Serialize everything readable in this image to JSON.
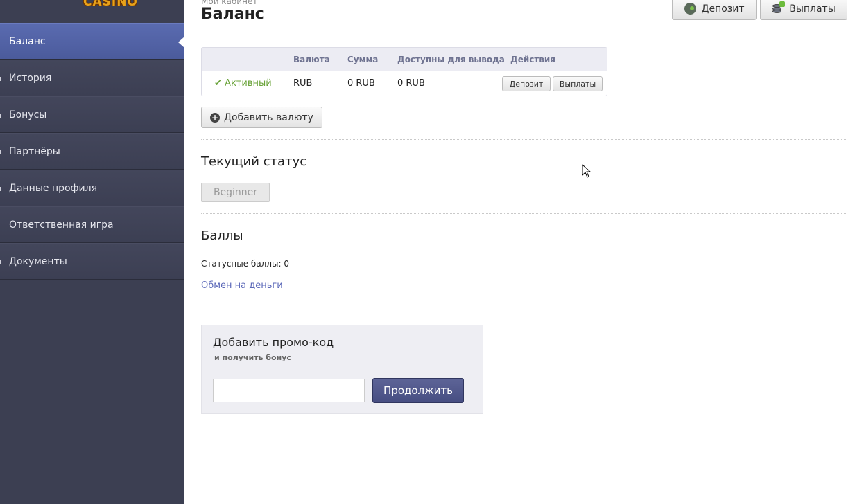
{
  "brand": {
    "logo_text": "CASINO"
  },
  "sidebar": {
    "items": [
      {
        "label": "Баланс",
        "active": true
      },
      {
        "label": "История"
      },
      {
        "label": "Бонусы"
      },
      {
        "label": "Партнёры"
      },
      {
        "label": "Данные профиля"
      },
      {
        "label": "Ответственная игра"
      },
      {
        "label": "Документы"
      }
    ]
  },
  "header": {
    "breadcrumb": "Мой кабинет",
    "title": "Баланс",
    "deposit_label": "Депозит",
    "payout_label": "Выплаты"
  },
  "balance_table": {
    "columns": [
      "Валюта",
      "Сумма",
      "Доступны для вывода",
      "Действия"
    ],
    "rows": [
      {
        "status": "Активный",
        "currency": "RUB",
        "amount": "0 RUB",
        "available": "0 RUB",
        "deposit_label": "Депозит",
        "payout_label": "Выплаты"
      }
    ]
  },
  "add_currency_label": "Добавить валюту",
  "status_section": {
    "title": "Текущий статус",
    "status": "Beginner"
  },
  "points_section": {
    "title": "Баллы",
    "status_points": "Статусные баллы: 0",
    "exchange_link": "Обмен на деньги"
  },
  "promo": {
    "title": "Добавить промо-код",
    "subtitle": "и получить бонус",
    "input_value": "",
    "submit_label": "Продолжить"
  },
  "colors": {
    "sidebar_bg": "#3c3f52",
    "active_item": "#5465a8",
    "accent_button": "#4e5589",
    "link": "#5a67b8",
    "active_status": "#6aa33a"
  }
}
